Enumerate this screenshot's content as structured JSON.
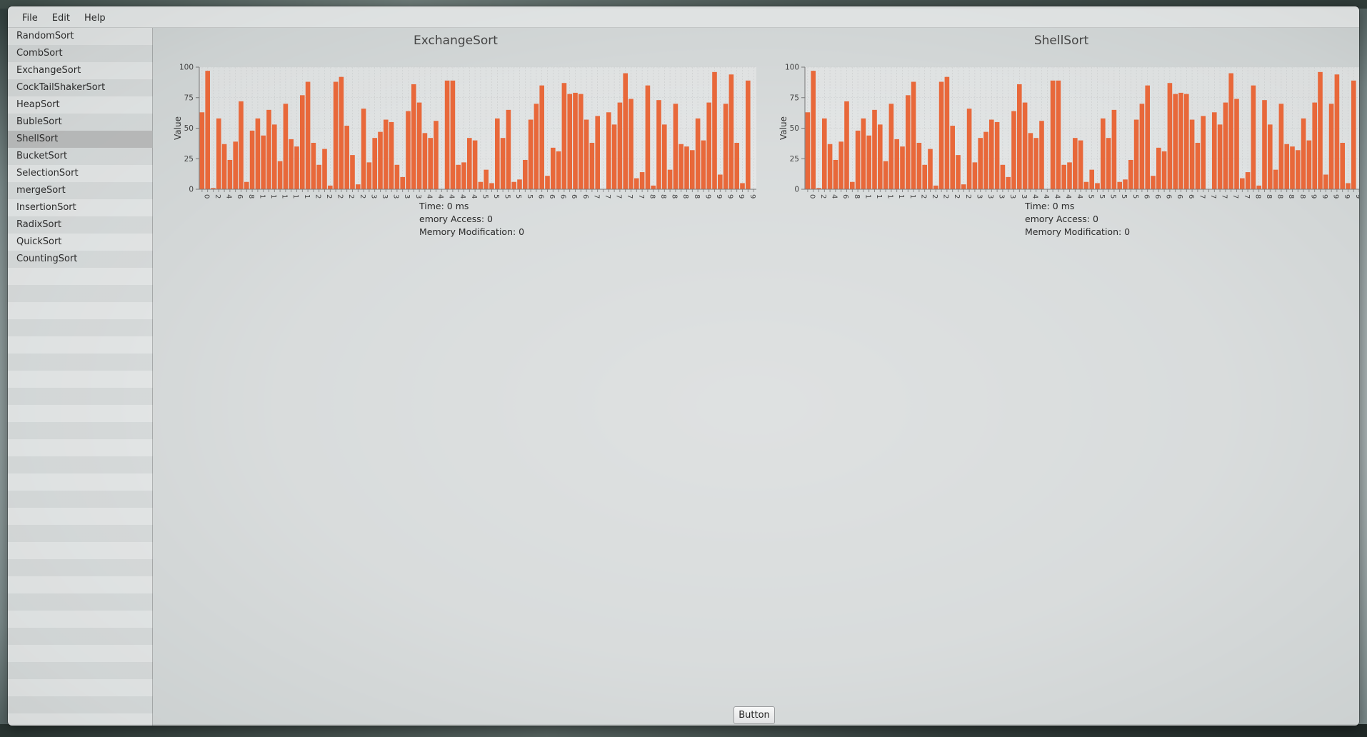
{
  "menubar": {
    "items": [
      "File",
      "Edit",
      "Help"
    ]
  },
  "sidebar": {
    "items": [
      "RandomSort",
      "CombSort",
      "ExchangeSort",
      "CockTailShakerSort",
      "HeapSort",
      "BubleSort",
      "ShellSort",
      "BucketSort",
      "SelectionSort",
      "mergeSort",
      "InsertionSort",
      "RadixSort",
      "QuickSort",
      "CountingSort"
    ],
    "selected": "ShellSort"
  },
  "bar_color": "#e8683a",
  "chart_data": [
    {
      "type": "bar",
      "title": "ExchangeSort",
      "ylabel": "Value",
      "xlabel": "",
      "ylim": [
        0,
        100
      ],
      "yticks": [
        0,
        25,
        50,
        75,
        100
      ],
      "grid": true,
      "x": [
        0,
        1,
        2,
        3,
        4,
        5,
        6,
        7,
        8,
        9,
        10,
        11,
        12,
        13,
        14,
        15,
        16,
        17,
        18,
        19,
        20,
        21,
        22,
        23,
        24,
        25,
        26,
        27,
        28,
        29,
        30,
        31,
        32,
        33,
        34,
        35,
        36,
        37,
        38,
        39,
        40,
        41,
        42,
        43,
        44,
        45,
        46,
        47,
        48,
        49,
        50,
        51,
        52,
        53,
        54,
        55,
        56,
        57,
        58,
        59,
        60,
        61,
        62,
        63,
        64,
        65,
        66,
        67,
        68,
        69,
        70,
        71,
        72,
        73,
        74,
        75,
        76,
        77,
        78,
        79,
        80,
        81,
        82,
        83,
        84,
        85,
        86,
        87,
        88,
        89,
        90,
        91,
        92,
        93,
        94,
        95,
        96,
        97,
        98,
        99
      ],
      "values": [
        63,
        97,
        1,
        58,
        37,
        24,
        39,
        72,
        6,
        48,
        58,
        44,
        65,
        53,
        23,
        70,
        41,
        35,
        77,
        88,
        38,
        20,
        33,
        3,
        88,
        92,
        52,
        28,
        4,
        66,
        22,
        42,
        47,
        57,
        55,
        20,
        10,
        64,
        86,
        71,
        46,
        42,
        56,
        0,
        89,
        89,
        20,
        22,
        42,
        40,
        6,
        16,
        5,
        58,
        42,
        65,
        6,
        8,
        24,
        57,
        70,
        85,
        11,
        34,
        31,
        87,
        78,
        79,
        78,
        57,
        38,
        60,
        0,
        63,
        53,
        71,
        95,
        74,
        9,
        14,
        85,
        3,
        73,
        53,
        16,
        70,
        37,
        35,
        32,
        58,
        40,
        71,
        96,
        12,
        70,
        94,
        38,
        5,
        89,
        0
      ]
    },
    {
      "type": "bar",
      "title": "ShellSort",
      "ylabel": "Value",
      "xlabel": "",
      "ylim": [
        0,
        100
      ],
      "yticks": [
        0,
        25,
        50,
        75,
        100
      ],
      "grid": true,
      "x": [
        0,
        1,
        2,
        3,
        4,
        5,
        6,
        7,
        8,
        9,
        10,
        11,
        12,
        13,
        14,
        15,
        16,
        17,
        18,
        19,
        20,
        21,
        22,
        23,
        24,
        25,
        26,
        27,
        28,
        29,
        30,
        31,
        32,
        33,
        34,
        35,
        36,
        37,
        38,
        39,
        40,
        41,
        42,
        43,
        44,
        45,
        46,
        47,
        48,
        49,
        50,
        51,
        52,
        53,
        54,
        55,
        56,
        57,
        58,
        59,
        60,
        61,
        62,
        63,
        64,
        65,
        66,
        67,
        68,
        69,
        70,
        71,
        72,
        73,
        74,
        75,
        76,
        77,
        78,
        79,
        80,
        81,
        82,
        83,
        84,
        85,
        86,
        87,
        88,
        89,
        90,
        91,
        92,
        93,
        94,
        95,
        96,
        97,
        98,
        99
      ],
      "values": [
        63,
        97,
        1,
        58,
        37,
        24,
        39,
        72,
        6,
        48,
        58,
        44,
        65,
        53,
        23,
        70,
        41,
        35,
        77,
        88,
        38,
        20,
        33,
        3,
        88,
        92,
        52,
        28,
        4,
        66,
        22,
        42,
        47,
        57,
        55,
        20,
        10,
        64,
        86,
        71,
        46,
        42,
        56,
        0,
        89,
        89,
        20,
        22,
        42,
        40,
        6,
        16,
        5,
        58,
        42,
        65,
        6,
        8,
        24,
        57,
        70,
        85,
        11,
        34,
        31,
        87,
        78,
        79,
        78,
        57,
        38,
        60,
        0,
        63,
        53,
        71,
        95,
        74,
        9,
        14,
        85,
        3,
        73,
        53,
        16,
        70,
        37,
        35,
        32,
        58,
        40,
        71,
        96,
        12,
        70,
        94,
        38,
        5,
        89,
        0
      ]
    }
  ],
  "stats": [
    {
      "time": "Time: 0 ms",
      "memory_access": "emory Access: 0",
      "memory_modification": "Memory Modification: 0"
    },
    {
      "time": "Time: 0 ms",
      "memory_access": "emory Access: 0",
      "memory_modification": "Memory Modification: 0"
    }
  ],
  "bottom_button": {
    "label": "Button"
  }
}
